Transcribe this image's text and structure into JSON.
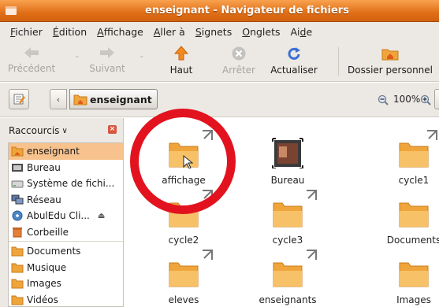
{
  "window": {
    "title": "enseignant - Navigateur de fichiers"
  },
  "menu": [
    {
      "label": "Fichier",
      "mnemonic": "F",
      "rest": "ichier"
    },
    {
      "label": "Édition",
      "mnemonic": "É",
      "rest": "dition"
    },
    {
      "label": "Affichage",
      "mnemonic": "A",
      "rest": "ffichage"
    },
    {
      "label": "Aller à",
      "mnemonic": "A",
      "rest": "ller à"
    },
    {
      "label": "Signets",
      "mnemonic": "S",
      "rest": "ignets"
    },
    {
      "label": "Onglets",
      "mnemonic": "O",
      "rest": "nglets"
    },
    {
      "label": "Aide",
      "pre": "Ai",
      "mnemonic": "d",
      "rest": "e"
    }
  ],
  "toolbar": {
    "back": "Précédent",
    "forward": "Suivant",
    "up": "Haut",
    "stop": "Arrêter",
    "reload": "Actualiser",
    "home": "Dossier personnel"
  },
  "location": {
    "back_arrow": "‹",
    "current": "enseignant",
    "zoom": "100%"
  },
  "sidebar": {
    "header": "Raccourcis",
    "items": [
      {
        "label": "enseignant",
        "icon": "home-folder-icon",
        "selected": true
      },
      {
        "label": "Bureau",
        "icon": "desktop-icon"
      },
      {
        "label": "Système de fichi...",
        "icon": "drive-icon"
      },
      {
        "label": "Réseau",
        "icon": "network-icon"
      },
      {
        "label": "AbulEdu Cli...",
        "icon": "cd-icon",
        "eject": true
      },
      {
        "label": "Corbeille",
        "icon": "trash-icon"
      },
      {
        "label": "Documents",
        "icon": "folder-icon"
      },
      {
        "label": "Musique",
        "icon": "folder-icon"
      },
      {
        "label": "Images",
        "icon": "folder-icon"
      },
      {
        "label": "Vidéos",
        "icon": "folder-icon"
      }
    ]
  },
  "files": [
    {
      "name": "affichage",
      "type": "folder-link"
    },
    {
      "name": "Bureau",
      "type": "desktop"
    },
    {
      "name": "cycle1",
      "type": "folder-link"
    },
    {
      "name": "cycle2",
      "type": "folder-link"
    },
    {
      "name": "cycle3",
      "type": "folder-link"
    },
    {
      "name": "Documents",
      "type": "folder"
    },
    {
      "name": "eleves",
      "type": "folder-link"
    },
    {
      "name": "enseignants",
      "type": "folder-link"
    },
    {
      "name": "Images",
      "type": "folder"
    }
  ],
  "colors": {
    "titlebar": "#e06f17",
    "selection": "#f7c28d",
    "highlight_ring": "#e2131f",
    "folder": "#f0a53c"
  }
}
